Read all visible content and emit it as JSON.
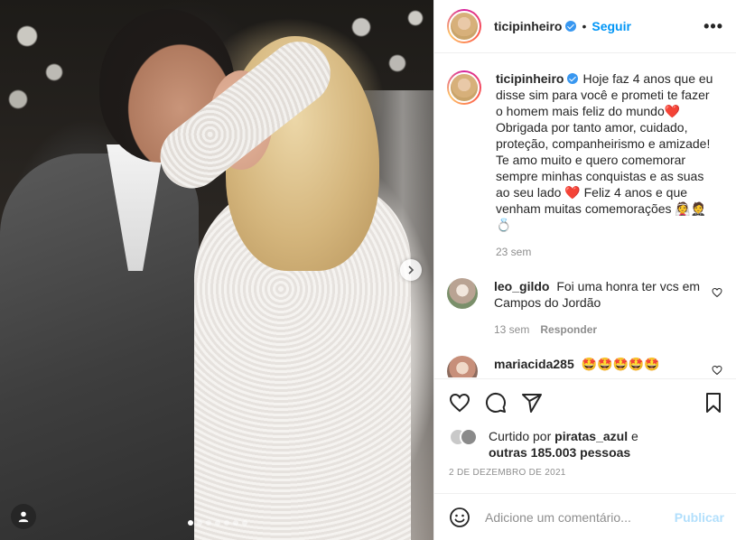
{
  "post": {
    "username": "ticipinheiro",
    "follow_label": "Seguir",
    "separator": "•",
    "more_label": "•••"
  },
  "caption": {
    "username": "ticipinheiro",
    "text": "Hoje faz 4 anos que eu disse sim para você e prometi te fazer o homem mais feliz do mundo❤️ Obrigada por tanto amor, cuidado, proteção, companheirismo e amizade! Te amo muito e quero comemorar sempre minhas conquistas e as suas ao seu lado ❤️ Feliz 4 anos e que venham muitas comemorações 👰🤵💍",
    "time": "23 sem"
  },
  "comments": [
    {
      "username": "leo_gildo",
      "text": "Foi uma honra ter vcs em Campos do Jordão",
      "time": "13 sem",
      "reply_label": "Responder"
    },
    {
      "username": "mariacida285",
      "text": "🤩🤩🤩🤩🤩"
    }
  ],
  "likes": {
    "prefix": "Curtido por",
    "user": "piratas_azul",
    "conj": "e",
    "others": "outras 185.003 pessoas"
  },
  "date": "2 DE DEZEMBRO DE 2021",
  "add_comment": {
    "placeholder": "Adicione um comentário...",
    "publish_label": "Publicar"
  },
  "carousel": {
    "slide_count": 7,
    "active_index": 0
  },
  "colors": {
    "accent": "#0095f6",
    "verified": "#3897f0",
    "publish_disabled": "#b2dffc",
    "muted": "#8e8e8e"
  }
}
